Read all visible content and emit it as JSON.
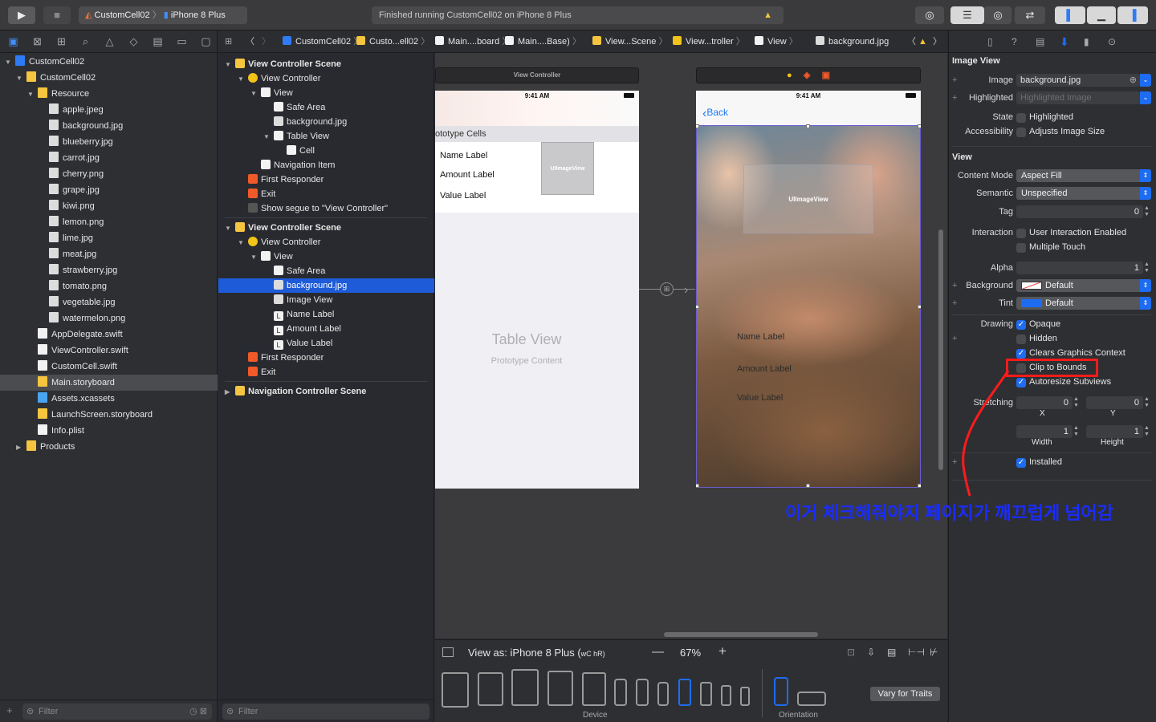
{
  "toolbar": {
    "run_icon": "play-icon",
    "stop_icon": "stop-icon",
    "scheme_project": "CustomCell02",
    "scheme_device": "iPhone 8 Plus",
    "status_text": "Finished running CustomCell02 on iPhone 8 Plus",
    "warning_icon": "warning-icon"
  },
  "navigator": {
    "items": [
      {
        "label": "CustomCell02",
        "level": 0,
        "kind": "project",
        "open": true
      },
      {
        "label": "CustomCell02",
        "level": 1,
        "kind": "folder",
        "open": true
      },
      {
        "label": "Resource",
        "level": 2,
        "kind": "folder",
        "open": true
      },
      {
        "label": "apple.jpeg",
        "level": 3,
        "kind": "image"
      },
      {
        "label": "background.jpg",
        "level": 3,
        "kind": "image"
      },
      {
        "label": "blueberry.jpg",
        "level": 3,
        "kind": "image"
      },
      {
        "label": "carrot.jpg",
        "level": 3,
        "kind": "image"
      },
      {
        "label": "cherry.png",
        "level": 3,
        "kind": "image"
      },
      {
        "label": "grape.jpg",
        "level": 3,
        "kind": "image"
      },
      {
        "label": "kiwi.png",
        "level": 3,
        "kind": "image"
      },
      {
        "label": "lemon.png",
        "level": 3,
        "kind": "image"
      },
      {
        "label": "lime.jpg",
        "level": 3,
        "kind": "image"
      },
      {
        "label": "meat.jpg",
        "level": 3,
        "kind": "image"
      },
      {
        "label": "strawberry.jpg",
        "level": 3,
        "kind": "image"
      },
      {
        "label": "tomato.png",
        "level": 3,
        "kind": "image"
      },
      {
        "label": "vegetable.jpg",
        "level": 3,
        "kind": "image"
      },
      {
        "label": "watermelon.png",
        "level": 3,
        "kind": "image"
      },
      {
        "label": "AppDelegate.swift",
        "level": 2,
        "kind": "swift"
      },
      {
        "label": "ViewController.swift",
        "level": 2,
        "kind": "swift"
      },
      {
        "label": "CustomCell.swift",
        "level": 2,
        "kind": "swift"
      },
      {
        "label": "Main.storyboard",
        "level": 2,
        "kind": "storyboard",
        "selected": true
      },
      {
        "label": "Assets.xcassets",
        "level": 2,
        "kind": "assets"
      },
      {
        "label": "LaunchScreen.storyboard",
        "level": 2,
        "kind": "storyboard"
      },
      {
        "label": "Info.plist",
        "level": 2,
        "kind": "plist"
      },
      {
        "label": "Products",
        "level": 1,
        "kind": "folder",
        "open": false
      }
    ],
    "filter_placeholder": "Filter"
  },
  "jumpbar": {
    "segments": [
      "CustomCell02",
      "Custo...ell02",
      "Main....board",
      "Main....Base)",
      "View...Scene",
      "View...troller",
      "View",
      "background.jpg"
    ]
  },
  "outline": {
    "items": [
      {
        "label": "View Controller Scene",
        "level": 0,
        "kind": "scene",
        "bold": true
      },
      {
        "label": "View Controller",
        "level": 1,
        "kind": "vc"
      },
      {
        "label": "View",
        "level": 2,
        "kind": "view"
      },
      {
        "label": "Safe Area",
        "level": 3,
        "kind": "view"
      },
      {
        "label": "background.jpg",
        "level": 3,
        "kind": "image"
      },
      {
        "label": "Table View",
        "level": 3,
        "kind": "view",
        "open": true
      },
      {
        "label": "Cell",
        "level": 4,
        "kind": "view"
      },
      {
        "label": "Navigation Item",
        "level": 2,
        "kind": "nav"
      },
      {
        "label": "First Responder",
        "level": 1,
        "kind": "responder"
      },
      {
        "label": "Exit",
        "level": 1,
        "kind": "exit"
      },
      {
        "label": "Show segue to \"View Controller\"",
        "level": 1,
        "kind": "segue"
      },
      {
        "label": "View Controller Scene",
        "level": 0,
        "kind": "scene",
        "bold": true
      },
      {
        "label": "View Controller",
        "level": 1,
        "kind": "vc"
      },
      {
        "label": "View",
        "level": 2,
        "kind": "view"
      },
      {
        "label": "Safe Area",
        "level": 3,
        "kind": "view"
      },
      {
        "label": "background.jpg",
        "level": 3,
        "kind": "image",
        "selected": true
      },
      {
        "label": "Image View",
        "level": 3,
        "kind": "image"
      },
      {
        "label": "Name Label",
        "level": 3,
        "kind": "label"
      },
      {
        "label": "Amount Label",
        "level": 3,
        "kind": "label"
      },
      {
        "label": "Value Label",
        "level": 3,
        "kind": "label"
      },
      {
        "label": "First Responder",
        "level": 1,
        "kind": "responder"
      },
      {
        "label": "Exit",
        "level": 1,
        "kind": "exit"
      },
      {
        "label": "Navigation Controller Scene",
        "level": 0,
        "kind": "scene",
        "bold": true
      }
    ],
    "filter_placeholder": "Filter"
  },
  "canvas": {
    "scene1": {
      "title": "View Controller",
      "time": "9:41 AM",
      "prototype_header": "ototype Cells",
      "name_label": "Name Label",
      "amount_label": "Amount Label",
      "value_label": "Value Label",
      "imageview_label": "UIImageView",
      "table_title": "Table View",
      "table_sub": "Prototype Content"
    },
    "scene2": {
      "time": "9:41 AM",
      "back": "Back",
      "imageview_label": "UIImageView",
      "name_label": "Name Label",
      "amount_label": "Amount Label",
      "value_label": "Value Label"
    }
  },
  "bottombar": {
    "view_as": "View as: iPhone 8 Plus (",
    "view_as_traits": "wC hR)",
    "zoom": "67%",
    "device_caption": "Device",
    "orientation_caption": "Orientation",
    "vary_button": "Vary for Traits"
  },
  "inspector": {
    "image_view_header": "Image View",
    "image_label": "Image",
    "image_value": "background.jpg",
    "highlighted_label": "Highlighted",
    "highlighted_placeholder": "Highlighted Image",
    "state_label": "State",
    "state_option": "Highlighted",
    "accessibility_label": "Accessibility",
    "accessibility_option": "Adjusts Image Size",
    "view_header": "View",
    "content_mode_label": "Content Mode",
    "content_mode_value": "Aspect Fill",
    "semantic_label": "Semantic",
    "semantic_value": "Unspecified",
    "tag_label": "Tag",
    "tag_value": "0",
    "interaction_label": "Interaction",
    "uie_option": "User Interaction Enabled",
    "mt_option": "Multiple Touch",
    "alpha_label": "Alpha",
    "alpha_value": "1",
    "background_label": "Background",
    "background_value": "Default",
    "tint_label": "Tint",
    "tint_value": "Default",
    "drawing_label": "Drawing",
    "opaque": "Opaque",
    "hidden": "Hidden",
    "clears": "Clears Graphics Context",
    "clip": "Clip to Bounds",
    "autoresize": "Autoresize Subviews",
    "stretching_label": "Stretching",
    "stretch_x": "0",
    "stretch_y": "0",
    "stretch_w": "1",
    "stretch_h": "1",
    "x_caption": "X",
    "y_caption": "Y",
    "w_caption": "Width",
    "h_caption": "Height",
    "installed": "Installed",
    "checks": {
      "highlighted": false,
      "adjusts": false,
      "uie": false,
      "mt": false,
      "opaque": true,
      "hidden": false,
      "clears": true,
      "clip": false,
      "autoresize": true,
      "installed": true
    }
  },
  "annotation": {
    "text": "이거 체크해줘야지 페이지가 깨끄럽게 넘어감",
    "color": "#1a2cff",
    "highlight_color": "#ff1b1b"
  }
}
